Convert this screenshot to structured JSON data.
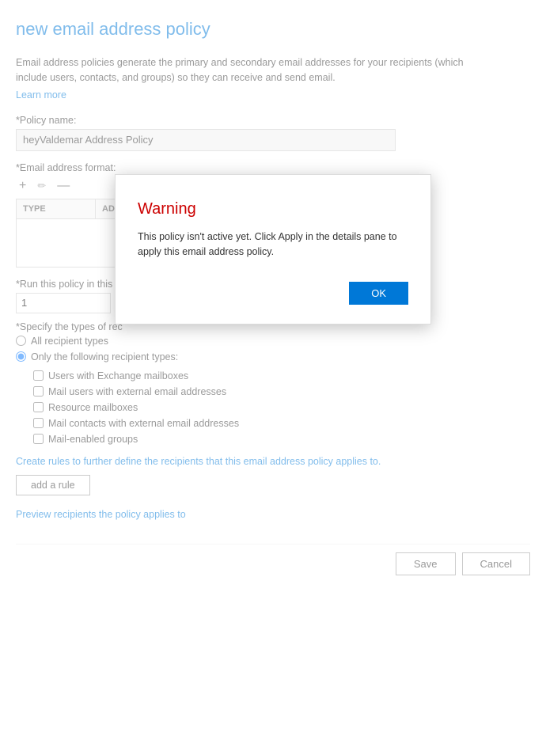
{
  "page": {
    "title": "new email address policy",
    "description": "Email address policies generate the primary and secondary email addresses for your recipients (which include users, contacts, and groups) so they can receive and send email.",
    "learn_more": "Learn more",
    "policy_name_label": "*Policy name:",
    "policy_name_value": "heyValdemar Address Policy",
    "email_format_label": "*Email address format:",
    "toolbar": {
      "add": "+",
      "edit": "✏",
      "remove": "—"
    },
    "table": {
      "col_type": "TYPE",
      "col_format": "ADDRESS FORMAT"
    },
    "run_policy_label": "*Run this policy in this s",
    "run_policy_value": "1",
    "recipient_types_label": "*Specify the types of rec",
    "radio_options": [
      {
        "id": "all",
        "label": "All recipient types"
      },
      {
        "id": "only",
        "label": "Only the following recipient types:"
      }
    ],
    "checkboxes": [
      {
        "id": "exchange",
        "label": "Users with Exchange mailboxes"
      },
      {
        "id": "mailusers",
        "label": "Mail users with external email addresses"
      },
      {
        "id": "resource",
        "label": "Resource mailboxes"
      },
      {
        "id": "mailcontacts",
        "label": "Mail contacts with external email addresses"
      },
      {
        "id": "mailenabled",
        "label": "Mail-enabled groups"
      }
    ],
    "rules_description": "Create rules to further define the recipients that this email address policy applies to.",
    "add_rule_label": "add a rule",
    "preview_link": "Preview recipients the policy applies to",
    "save_label": "Save",
    "cancel_label": "Cancel"
  },
  "modal": {
    "title": "Warning",
    "body": "This policy isn't active yet. Click Apply in the details pane to apply this email address policy.",
    "ok_label": "OK"
  }
}
